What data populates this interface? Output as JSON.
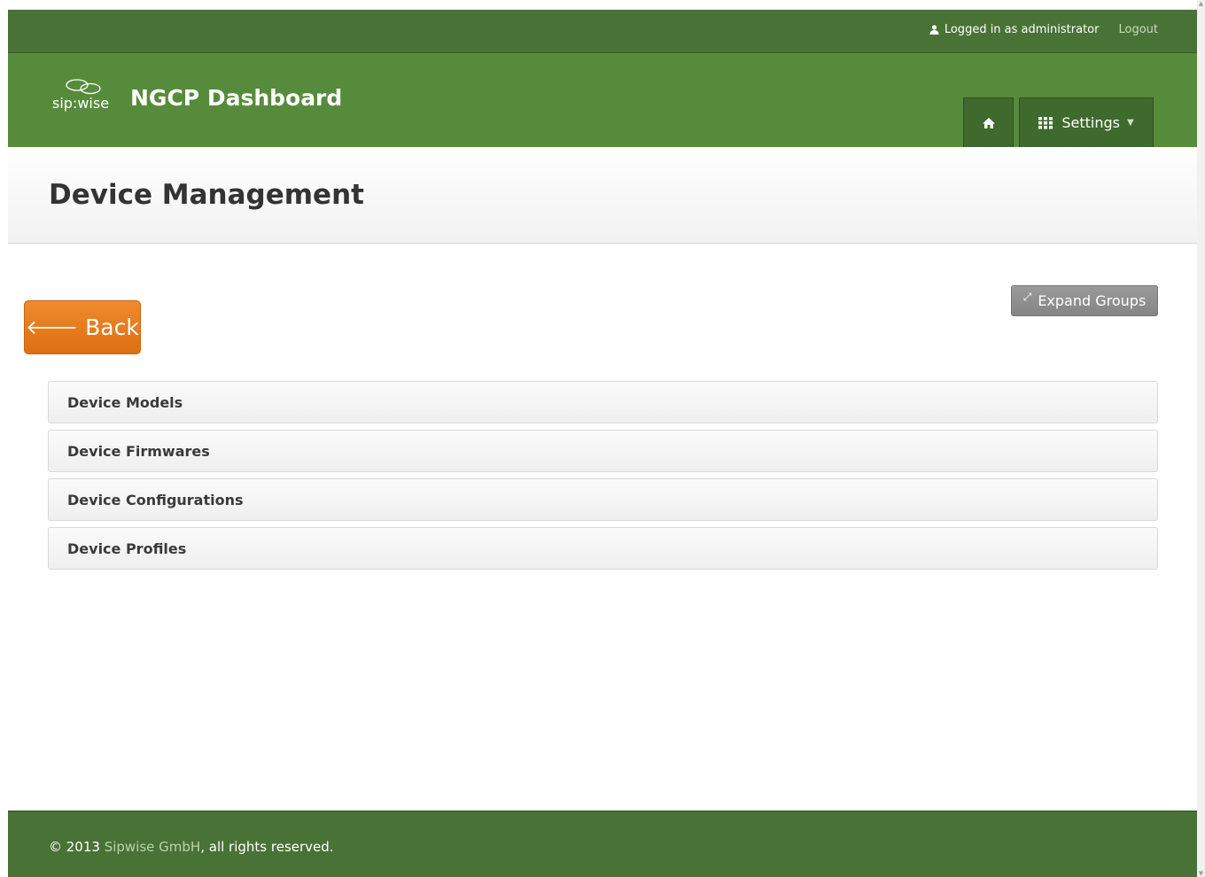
{
  "topbar": {
    "logged_in_text": "Logged in as administrator",
    "logout_label": "Logout"
  },
  "header": {
    "logo_text": "sip:wise",
    "app_title": "NGCP Dashboard",
    "home_icon": "home-icon",
    "settings_label": "Settings",
    "settings_icon": "grid-icon"
  },
  "page": {
    "title": "Device Management",
    "back_label": "Back",
    "expand_label": "Expand Groups"
  },
  "groups": [
    {
      "label": "Device Models"
    },
    {
      "label": "Device Firmwares"
    },
    {
      "label": "Device Configurations"
    },
    {
      "label": "Device Profiles"
    }
  ],
  "footer": {
    "prefix": "© 2013",
    "company": "Sipwise GmbH",
    "suffix": ", all rights reserved."
  },
  "colors": {
    "topbar": "#497237",
    "header": "#568b3c",
    "back_button": "#e67c1f",
    "expand_button": "#8c8c8c"
  }
}
